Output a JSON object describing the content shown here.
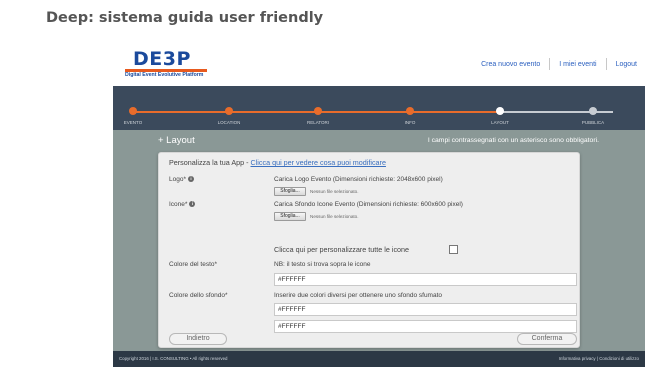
{
  "slide": {
    "title": "Deep: sistema guida user friendly"
  },
  "header": {
    "logo_text": "DE3P",
    "logo_subtitle": "Digital Event Evolutive Platform",
    "nav": [
      "Crea nuovo evento",
      "I miei eventi",
      "Logout"
    ]
  },
  "stepper": {
    "accent_color": "#e86c2b",
    "current_color": "#ffffff",
    "pending_color": "#c7ccd2",
    "steps": [
      {
        "label": "EVENTO",
        "state": "done"
      },
      {
        "label": "LOCATION",
        "state": "done"
      },
      {
        "label": "RELATORI",
        "state": "done"
      },
      {
        "label": "INFO",
        "state": "done"
      },
      {
        "label": "LAYOUT",
        "state": "current"
      },
      {
        "label": "PUBBLICA",
        "state": "pending"
      }
    ]
  },
  "content": {
    "title": "+ Layout",
    "required_note": "I campi contrassegnati con un asterisco sono obbligatori."
  },
  "form": {
    "subtitle_prefix": "Personalizza la tua App - ",
    "subtitle_link": "Clicca qui per vedere cosa puoi modificare",
    "logo_label": "Logo*",
    "logo_hint": "Carica Logo Evento (Dimensioni richieste: 2048x600 pixel)",
    "icone_label": "Icone*",
    "icone_hint": "Carica Sfondo Icone Evento (Dimensioni richieste: 600x600 pixel)",
    "browse_label": "Sfoglia...",
    "no_file": "Nessun file selezionato.",
    "customize_icons_label": "Clicca qui per personalizzare tutte le icone",
    "customize_icons_checked": false,
    "text_color_label": "Colore del testo*",
    "text_color_note": "NB: il testo si trova sopra le icone",
    "text_color_value": "#FFFFFF",
    "bg_color_label": "Colore dello sfondo*",
    "bg_color_note": "Inserire due colori diversi per ottenere uno sfondo sfumato",
    "bg_color_1": "#FFFFFF",
    "bg_color_2": "#FFFFFF",
    "back_button": "Indietro",
    "confirm_button": "Conferma"
  },
  "footer": {
    "copyright": "Copyright 2016 | I.S. CONSULTING • All rights reserved",
    "links": "Informativa privacy | Condizioni di utilizzo"
  },
  "colors": {
    "header_bg": "#3b4a5c",
    "content_bg": "#8a9896",
    "footer_bg": "#2c3845",
    "link": "#2a5fbf"
  }
}
